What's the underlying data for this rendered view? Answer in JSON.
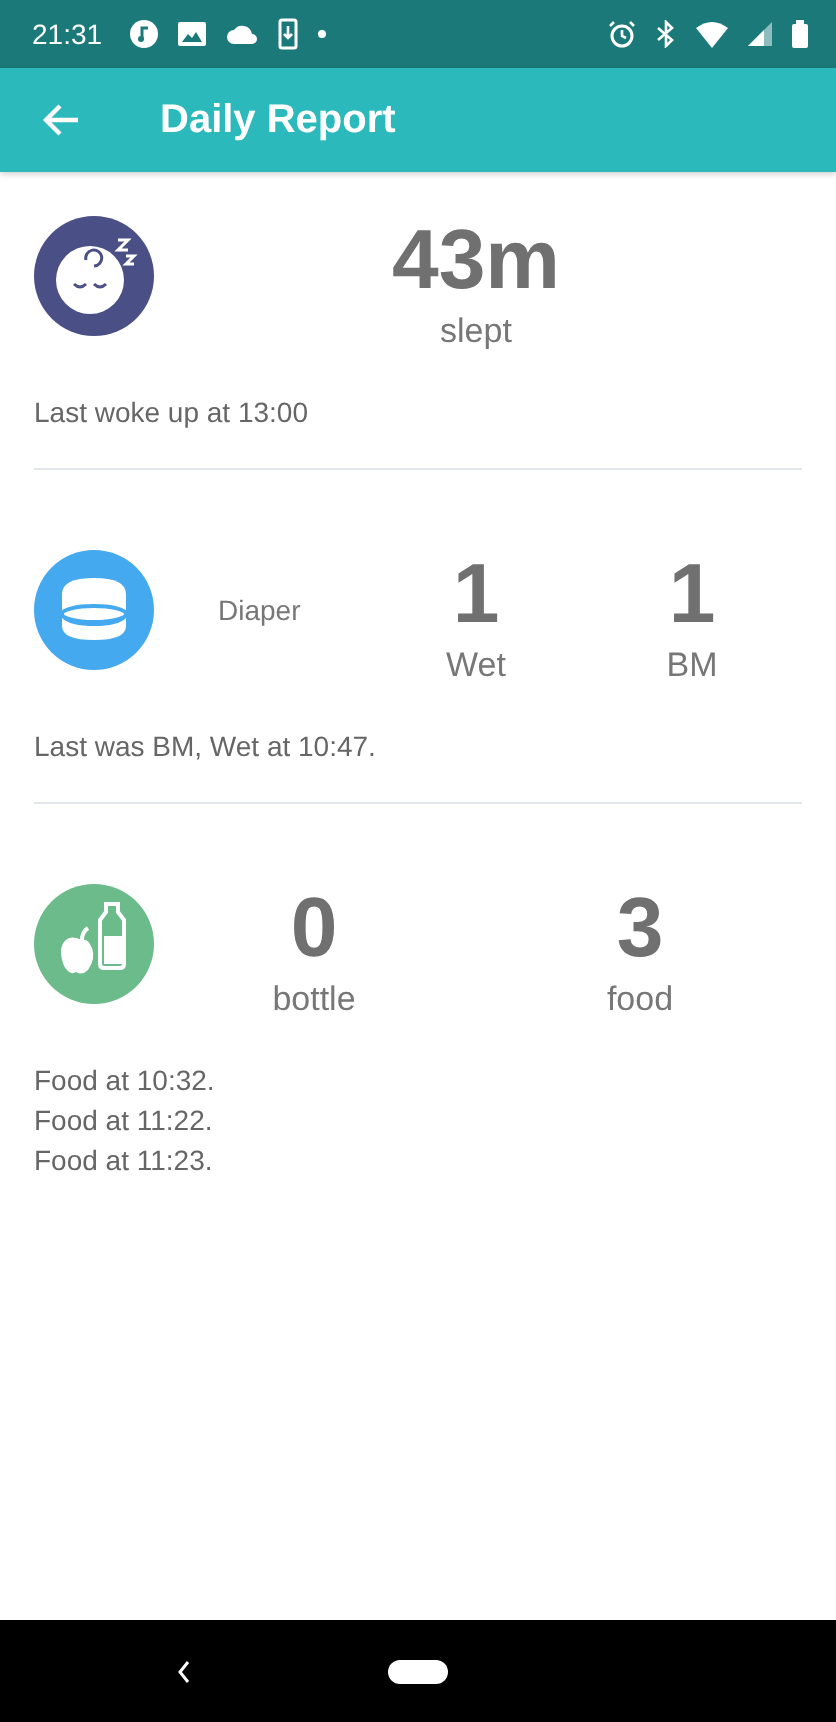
{
  "status_bar": {
    "time": "21:31"
  },
  "app_bar": {
    "title": "Daily Report"
  },
  "sections": [
    {
      "kind": "sleep",
      "stats": [
        {
          "value": "43m",
          "label": "slept"
        }
      ],
      "notes": [
        "Last woke up at 13:00"
      ]
    },
    {
      "kind": "diaper",
      "label": "Diaper",
      "stats": [
        {
          "value": "1",
          "label": "Wet"
        },
        {
          "value": "1",
          "label": "BM"
        }
      ],
      "notes": [
        "Last was BM, Wet at 10:47."
      ]
    },
    {
      "kind": "feeding",
      "stats": [
        {
          "value": "0",
          "label": "bottle"
        },
        {
          "value": "3",
          "label": "food"
        }
      ],
      "notes": [
        "Food at 10:32.",
        "Food at 11:22.",
        "Food at 11:23."
      ]
    }
  ]
}
